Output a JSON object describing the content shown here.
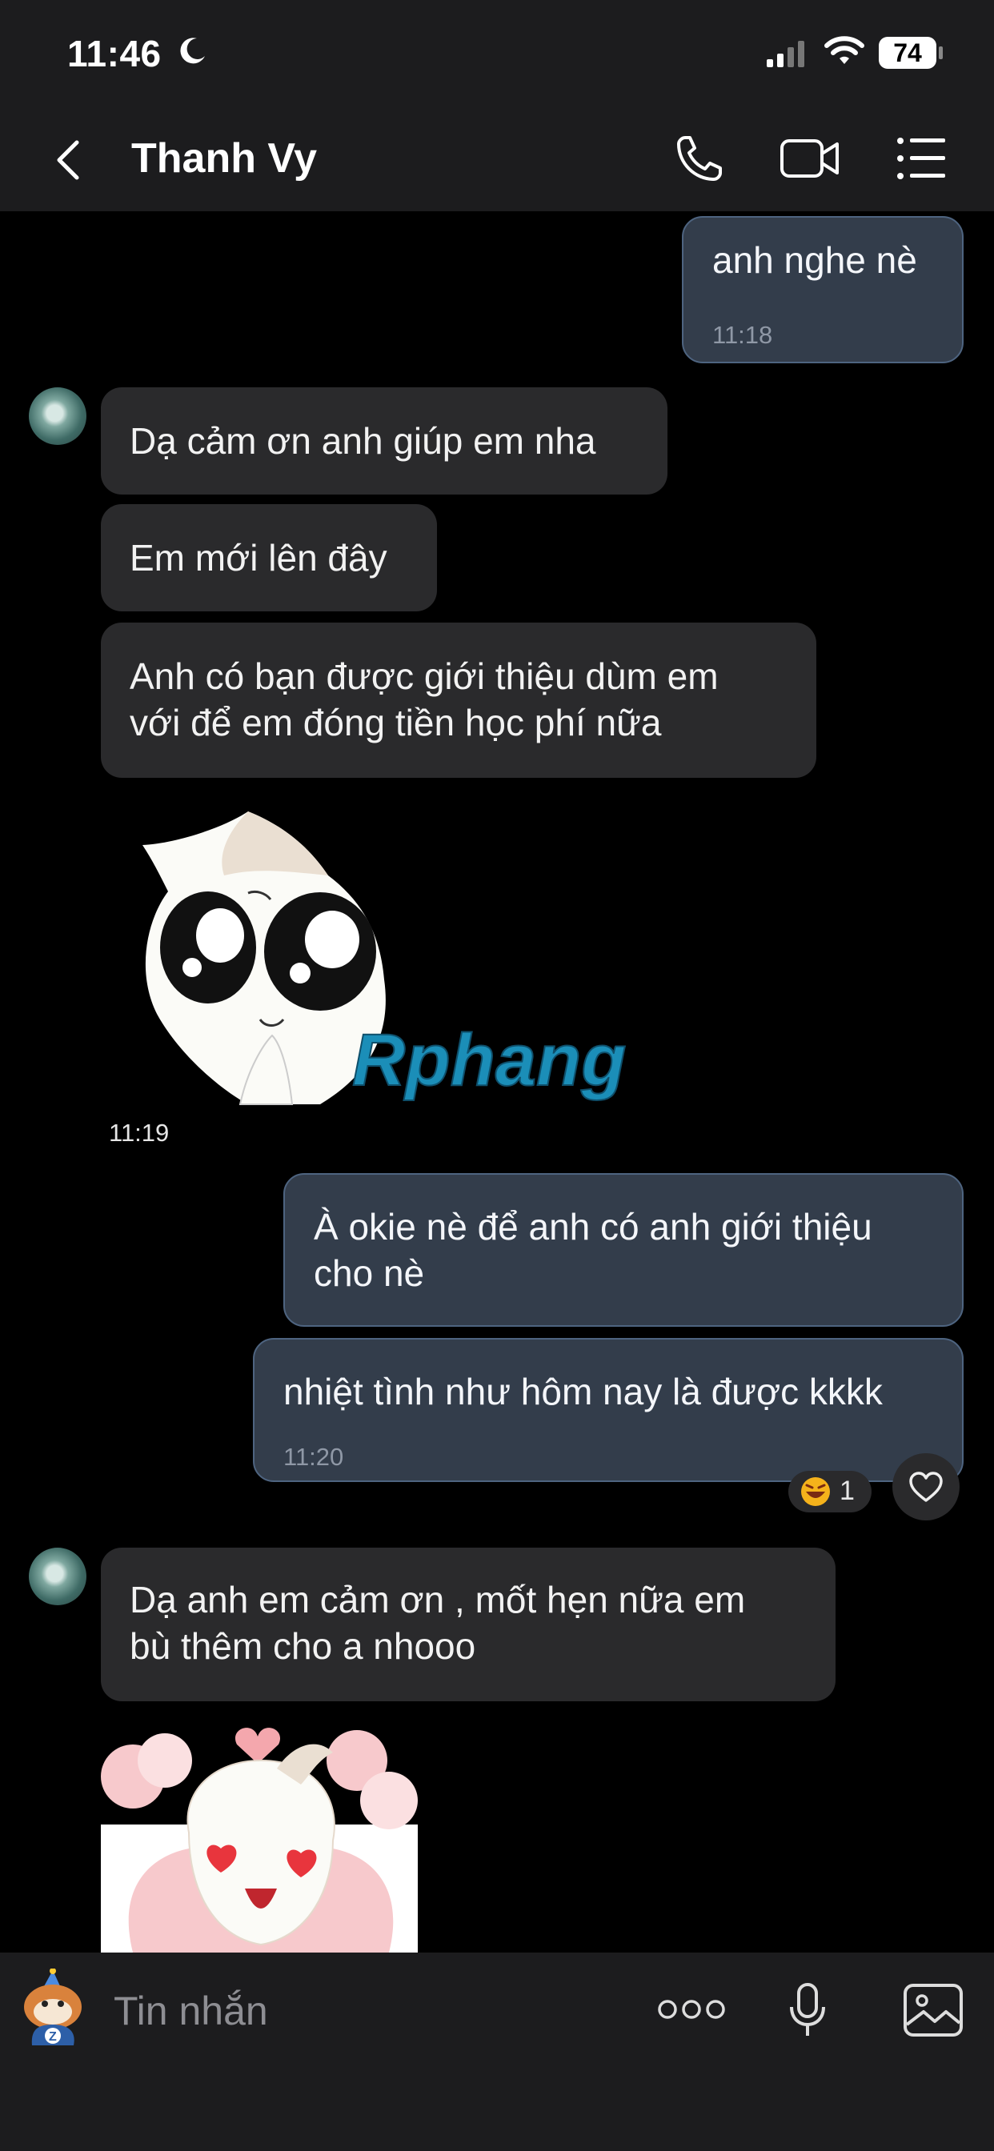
{
  "status_bar": {
    "time": "11:46",
    "battery": "74"
  },
  "header": {
    "contact_name": "Thanh Vy"
  },
  "messages": {
    "m1": {
      "text": "anh nghe nè",
      "time": "11:18"
    },
    "m2": {
      "text": "Dạ cảm ơn anh giúp em nha"
    },
    "m3": {
      "text": "Em mới lên đây"
    },
    "m4": {
      "line1": "Anh có bạn được giới thiệu dùm em",
      "line2": "với để em đóng tiền học phí nữa"
    },
    "sticker1": {
      "watermark": "Rphang",
      "time": "11:19"
    },
    "m5": {
      "line1": "À okie nè để anh có anh giới thiệu",
      "line2": "cho nè"
    },
    "m6": {
      "text": "nhiệt tình như hôm nay là được kkkk",
      "time": "11:20",
      "reaction_count": "1"
    },
    "m7": {
      "line1": "Dạ anh em cảm ơn , mốt hẹn nữa em",
      "line2": "bù thêm cho a nhooo"
    }
  },
  "composer": {
    "placeholder": "Tin nhắn"
  },
  "colors": {
    "incoming_bubble": "#2a2a2c",
    "outgoing_bubble": "#333d4b",
    "outgoing_border": "#4e6480",
    "bar_bg": "#1c1c1e"
  }
}
